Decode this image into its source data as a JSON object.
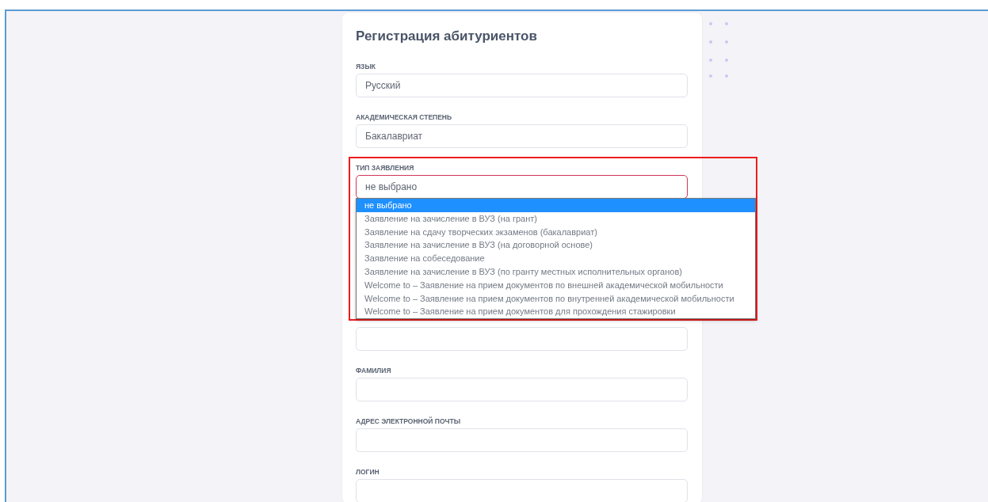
{
  "title": "Регистрация абитуриентов",
  "fields": [
    {
      "kind": "select",
      "label": "ЯЗЫК",
      "value": "Русский",
      "invalid": false
    },
    {
      "kind": "select",
      "label": "АКАДЕМИЧЕСКАЯ СТЕПЕНЬ",
      "value": "Бакалавриат",
      "invalid": false
    },
    {
      "kind": "select",
      "label": "ТИП ЗАЯВЛЕНИЯ",
      "value": "не выбрано",
      "invalid": true,
      "expanded": true,
      "options": [
        {
          "label": "не выбрано",
          "selected": true
        },
        {
          "label": "Заявление на зачисление в ВУЗ (на грант)",
          "selected": false
        },
        {
          "label": "Заявление на сдачу творческих экзаменов (бакалавриат)",
          "selected": false
        },
        {
          "label": "Заявление на зачисление в ВУЗ (на договорной основе)",
          "selected": false
        },
        {
          "label": "Заявление на собеседование",
          "selected": false
        },
        {
          "label": "Заявление на зачисление в ВУЗ (по гранту местных исполнительных органов)",
          "selected": false
        },
        {
          "label": "Welcome to – Заявление на прием документов по внешней академической мобильности",
          "selected": false
        },
        {
          "label": "Welcome to – Заявление на прием документов по внутренней академической мобильности",
          "selected": false
        },
        {
          "label": "Welcome to – Заявление на прием документов для прохождения стажировки",
          "selected": false
        }
      ]
    },
    {
      "kind": "input",
      "invalid": false
    },
    {
      "kind": "input",
      "label": "ФАМИЛИЯ",
      "invalid": false
    },
    {
      "kind": "input",
      "label": "АДРЕС ЭЛЕКТРОННОЙ ПОЧТЫ",
      "invalid": false
    },
    {
      "kind": "input",
      "label": "ЛОГИН",
      "invalid": false
    }
  ]
}
